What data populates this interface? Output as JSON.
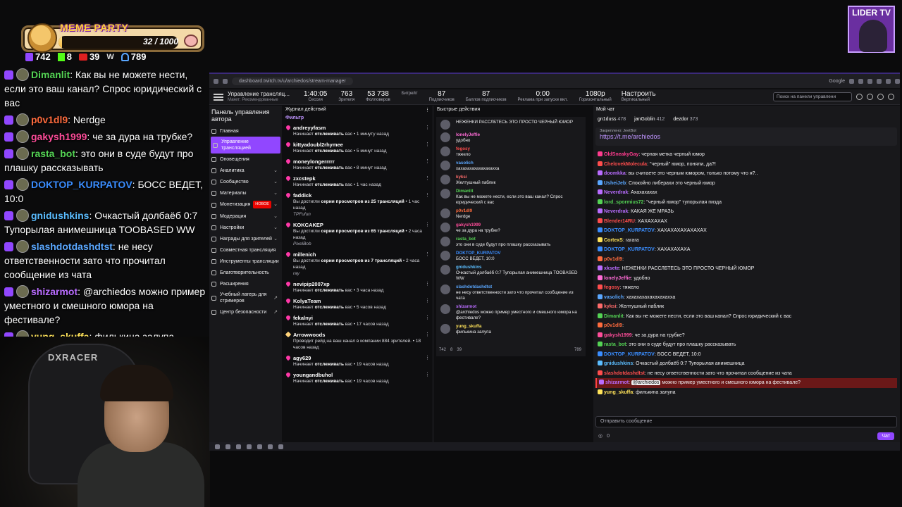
{
  "meme_party": {
    "title": "MEME PARTY",
    "progress": "32 / 1000",
    "progress_fraction": 0.032
  },
  "stream_stats": {
    "twitch": "742",
    "kick": "8",
    "live": "39",
    "w_icon": "W",
    "total": "789"
  },
  "overlay_chat": [
    {
      "name": "Dimanlit",
      "name_color": "#54d354",
      "text": "Как вы не можете нести, если это ваш канал? Спрос юридический с вас"
    },
    {
      "name": "p0v1dl9",
      "name_color": "#ff6b3d",
      "text": "Nerdge"
    },
    {
      "name": "gakysh1999",
      "name_color": "#ff4d9a",
      "text": "че за дура на трубке?"
    },
    {
      "name": "rasta_bot",
      "name_color": "#54d354",
      "text": "это они в суде будут про плашку рассказывать"
    },
    {
      "name": "DOKTOP_KURPATOV",
      "name_color": "#3a8dff",
      "text": "БОСС ВЕДЕТ, 10:0"
    },
    {
      "name": "gnidushkins",
      "name_color": "#5bbdff",
      "text": "Очкастый долбаёб 0:7 Тупорылая анимешница TOOBASED WW"
    },
    {
      "name": "slashdotdashdtst",
      "name_color": "#5aa7ff",
      "text": "не несу ответственности зато что прочитал сообщение из чата"
    },
    {
      "name": "shizarmot",
      "name_color": "#b96cff",
      "text": "@archiedos можно пример уместного и смешного юмора на фестивале?"
    },
    {
      "name": "yung_skuffa",
      "name_color": "#ffe35a",
      "text": "филькина залупа"
    }
  ],
  "webcam": {
    "chair_logo": "DXRACER"
  },
  "lider_tv": {
    "label": "LIDER TV"
  },
  "browser": {
    "url": "dashboard.twitch.tv/u/archiedos/stream-manager",
    "google_label": "Google"
  },
  "header": {
    "title": "Управление трансляц...",
    "subtitle": "Макет: Рекомендованные",
    "stats": [
      {
        "value": "1:40:05",
        "label": "Сессия"
      },
      {
        "value": "763",
        "label": "Зрителя"
      },
      {
        "value": "53 738",
        "label": "Фолловеров"
      },
      {
        "value": "",
        "label": "Битрейт"
      },
      {
        "value": "87",
        "label": "Подписчиков"
      },
      {
        "value": "87",
        "label": "Баллов подписчиков"
      },
      {
        "value": "0:00",
        "label": "Реклама при запуске вкл."
      }
    ],
    "resolution": "1080p",
    "resolution_label": "Горизонтальный",
    "settings_label": "Настроить",
    "settings_sub": "Вертикальный",
    "search_placeholder": "Поиск на панели управлени"
  },
  "nav": {
    "title": "Панель управления автора",
    "items": [
      {
        "label": "Главная",
        "active": false,
        "chevron": "",
        "badge": ""
      },
      {
        "label": "Управление трансляцией",
        "active": true,
        "chevron": "",
        "badge": ""
      },
      {
        "label": "Оповещения",
        "active": false,
        "chevron": "",
        "badge": ""
      },
      {
        "label": "Аналитика",
        "active": false,
        "chevron": "⌄",
        "badge": ""
      },
      {
        "label": "Сообщество",
        "active": false,
        "chevron": "⌄",
        "badge": ""
      },
      {
        "label": "Материалы",
        "active": false,
        "chevron": "⌄",
        "badge": ""
      },
      {
        "label": "Монетизация",
        "active": false,
        "chevron": "⌄",
        "badge": "НОВОЕ"
      },
      {
        "label": "Модерация",
        "active": false,
        "chevron": "⌄",
        "badge": ""
      },
      {
        "label": "Настройки",
        "active": false,
        "chevron": "⌄",
        "badge": ""
      },
      {
        "label": "Награды для зрителей",
        "active": false,
        "chevron": "⌄",
        "badge": ""
      },
      {
        "label": "Совместная трансляция",
        "active": false,
        "chevron": "",
        "badge": ""
      },
      {
        "label": "Инструменты трансляции",
        "active": false,
        "chevron": "",
        "badge": ""
      },
      {
        "label": "Благотворительность",
        "active": false,
        "chevron": "",
        "badge": ""
      },
      {
        "label": "Расширения",
        "active": false,
        "chevron": "",
        "badge": ""
      },
      {
        "label": "Учебный лагерь для стримеров",
        "active": false,
        "chevron": "↗",
        "badge": ""
      },
      {
        "label": "Центр безопасности",
        "active": false,
        "chevron": "↗",
        "badge": ""
      }
    ]
  },
  "activity": {
    "title": "Журнал действий",
    "filter_label": "Фильтр",
    "items": [
      {
        "user": "andreyyfasm",
        "text_pre": "Начинает ",
        "text_bold": "отслеживать",
        "text_post": " вас • 1 минуту назад",
        "msg": "",
        "kind": "heart"
      },
      {
        "user": "kittyadoubl2rhymee",
        "text_pre": "Начинает ",
        "text_bold": "отслеживать",
        "text_post": " вас • 5 минут назад",
        "msg": "",
        "kind": "heart"
      },
      {
        "user": "moneylongerrrrr",
        "text_pre": "Начинает ",
        "text_bold": "отслеживать",
        "text_post": " вас • 8 минут назад",
        "msg": "",
        "kind": "heart"
      },
      {
        "user": "zxcstepk",
        "text_pre": "Начинает ",
        "text_bold": "отслеживать",
        "text_post": " вас • 1 час назад",
        "msg": "",
        "kind": "heart"
      },
      {
        "user": "faddick",
        "text_pre": "Вы достигли ",
        "text_bold": "серии просмотров из 25 трансляций",
        "text_post": " • 1 час назад",
        "msg": "TPFufun",
        "kind": "heart"
      },
      {
        "user": "KOKCAKEP",
        "text_pre": "Вы достигли ",
        "text_bold": "серии просмотров из 65 трансляций",
        "text_post": " • 2 часа назад",
        "msg": "PixelBob",
        "kind": "heart"
      },
      {
        "user": "millenich",
        "text_pre": "Вы достигли ",
        "text_bold": "серии просмотров из 7 трансляций",
        "text_post": " • 2 часа назад",
        "msg": "ray",
        "kind": "heart"
      },
      {
        "user": "nevipip2007xp",
        "text_pre": "Начинает ",
        "text_bold": "отслеживать",
        "text_post": " вас • 3 часа назад",
        "msg": "",
        "kind": "heart"
      },
      {
        "user": "KolyaTeam",
        "text_pre": "Начинает ",
        "text_bold": "отслеживать",
        "text_post": " вас • 5 часов назад",
        "msg": "",
        "kind": "heart"
      },
      {
        "user": "fekalnyi",
        "text_pre": "Начинает ",
        "text_bold": "отслеживать",
        "text_post": " вас • 17 часов назад",
        "msg": "",
        "kind": "heart"
      },
      {
        "user": "Arrowwoods",
        "text_pre": "Проводит рейд",
        "text_bold": "",
        "text_post": " на ваш канал в компании 884 зрителей. • 18 часов назад",
        "msg": "",
        "kind": "star"
      },
      {
        "user": "agy629",
        "text_pre": "Начинает ",
        "text_bold": "отслеживать",
        "text_post": " вас • 19 часов назад",
        "msg": "",
        "kind": "heart"
      },
      {
        "user": "youngandbuhol",
        "text_pre": "Начинает ",
        "text_bold": "отслеживать",
        "text_post": " вас • 19 часов назад",
        "msg": "",
        "kind": "heart"
      }
    ]
  },
  "quick_actions": {
    "title": "Быстрые действия",
    "messages": [
      {
        "name": "",
        "color": "#ffffff",
        "text": "НЕЖЕНКИ РАССЛБТЕСЬ ЭТО ПРОСТО ЧЕРНЫЙ ЮМОР"
      },
      {
        "name": "lonelyJeffie",
        "color": "#ff6bd6",
        "text": "удобно"
      },
      {
        "name": "fegosy",
        "color": "#ff4d4d",
        "text": "тяжело"
      },
      {
        "name": "vasolich",
        "color": "#5aa7ff",
        "text": "хахахахахахахахахха"
      },
      {
        "name": "kyksi",
        "color": "#ff6b6b",
        "text": "Желтушный паблик"
      },
      {
        "name": "Dimanlit",
        "color": "#54d354",
        "text": "Как вы не можете нести, если это ваш канал? Спрос юридический с вас"
      },
      {
        "name": "p0v1dl9",
        "color": "#ff6b3d",
        "text": "Nerdge"
      },
      {
        "name": "gakysh1999",
        "color": "#ff4d9a",
        "text": "че за дура на трубке?"
      },
      {
        "name": "rasta_bot",
        "color": "#54d354",
        "text": "это они в суде будут про плашку рассказывать"
      },
      {
        "name": "DOKTOP_KURPATOV",
        "color": "#3a8dff",
        "text": "БОСС ВЕДЕТ, 10:0"
      },
      {
        "name": "gnidushkins",
        "color": "#5bbdff",
        "text": "Очкастый долбаёб 0:7 Тупорылая анимешница TOOBASED WW"
      },
      {
        "name": "slashdotdashdtst",
        "color": "#5aa7ff",
        "text": "не несу ответственности зато что прочитал сообщение из чата"
      },
      {
        "name": "shizarmot",
        "color": "#b96cff",
        "text": "@archiedos можно пример уместного и смешного юмора на фестивале?"
      },
      {
        "name": "yung_skuffa",
        "color": "#ffe35a",
        "text": "филькина залупа"
      }
    ],
    "footer": {
      "tw": "742",
      "kick": "8",
      "live": "39",
      "total": "789"
    }
  },
  "my_chat": {
    "title": "Мой чат",
    "leaders": [
      {
        "name": "gn1duss",
        "value": "478"
      },
      {
        "name": "janGoblin",
        "value": "412"
      },
      {
        "name": "dezdor",
        "value": "373"
      }
    ],
    "pinned_label": "Закреплено: JeetBot",
    "pinned_link": "https://t.me/archiedos",
    "lines": [
      {
        "name": "OldSneakyGay",
        "color": "#ff3c8e",
        "text": ": черная метка черный юмор",
        "hl": false
      },
      {
        "name": "ChelovekMolecula",
        "color": "#ff4d4d",
        "text": ": \"черный\" юмор, поняли, да?!",
        "hl": false
      },
      {
        "name": "doomkka",
        "color": "#b96cff",
        "text": ": вы считаете это черным юмором, только потому что я?..",
        "hl": false
      },
      {
        "name": "UsheiJeb",
        "color": "#5aa7ff",
        "text": ": Спокойно либерахи это черный юмор",
        "hl": false
      },
      {
        "name": "Neverdrak",
        "color": "#b96cff",
        "text": ": Ахахахахах",
        "hl": false
      },
      {
        "name": "lord_spormius72",
        "color": "#54d354",
        "text": ": \"черный юмор\" тупорылая пизда",
        "hl": false
      },
      {
        "name": "Neverdrak",
        "color": "#b96cff",
        "text": ": КАКАЯ ЖЕ МРАЗЬ",
        "hl": false
      },
      {
        "name": "Blender14RU",
        "color": "#ff4d4d",
        "text": ": ХАХАХАХАХ",
        "hl": false
      },
      {
        "name": "DOKTOP_KURPATOV",
        "color": "#3a8dff",
        "text": ": ХАХАХАХАХАХАХАХ",
        "hl": false
      },
      {
        "name": "CortexS",
        "color": "#ffe35a",
        "text": ": гагага",
        "hl": false
      },
      {
        "name": "DOKTOP_KURPATOV",
        "color": "#3a8dff",
        "text": ": ХАХАХАХАХА",
        "hl": false
      },
      {
        "name": "p0v1dl9",
        "color": "#ff6b3d",
        "text": ":",
        "hl": false
      },
      {
        "name": "xksete",
        "color": "#b96cff",
        "text": ": НЕЖЕНКИ РАССЛБТЕСЬ ЭТО ПРОСТО ЧЕРНЫЙ ЮМОР",
        "hl": false
      },
      {
        "name": "lonelyJeffie",
        "color": "#ff6bd6",
        "text": ": удобно",
        "hl": false
      },
      {
        "name": "fegosy",
        "color": "#ff4d4d",
        "text": ": тяжело",
        "hl": false
      },
      {
        "name": "vasolich",
        "color": "#5aa7ff",
        "text": ": хахахахахахахахахха",
        "hl": false
      },
      {
        "name": "kyksi",
        "color": "#ff6b6b",
        "text": ": Желтушный паблик",
        "hl": false
      },
      {
        "name": "Dimanlit",
        "color": "#54d354",
        "text": ": Как вы не можете нести, если это ваш канал? Спрос юридический с вас",
        "hl": false
      },
      {
        "name": "p0v1dl9",
        "color": "#ff6b3d",
        "text": ":",
        "hl": false
      },
      {
        "name": "gakysh1999",
        "color": "#ff4d9a",
        "text": ": че за дура на трубке?",
        "hl": false
      },
      {
        "name": "rasta_bot",
        "color": "#54d354",
        "text": ": это они в суде будут про плашку рассказывать",
        "hl": false
      },
      {
        "name": "DOKTOP_KURPATOV",
        "color": "#3a8dff",
        "text": ": БОСС ВЕДЕТ, 10:0",
        "hl": false
      },
      {
        "name": "gnidushkins",
        "color": "#5bbdff",
        "text": ": Очкастый долбаёб 0:7 Тупорылая анимешница",
        "hl": false
      },
      {
        "name": "slashdotdashdtst",
        "color": "#ff4d4d",
        "text": ": не несу ответственности зато что прочитал сообщение из чата",
        "hl": false
      },
      {
        "name": "shizarmot",
        "color": "#b96cff",
        "text": " можно пример уместного и смешного юмора на фестивале?",
        "hl": true,
        "mention": "@archiedos"
      },
      {
        "name": "yung_skuffa",
        "color": "#ffe35a",
        "text": ": филькина залупа",
        "hl": false
      }
    ],
    "send_placeholder": "Отправить сообщение",
    "points": "0",
    "chat_button": "Чат"
  },
  "colors": {
    "twitch_purple": "#9147ff",
    "new_badge": "#eb0400",
    "highlight": "#6b1818"
  }
}
